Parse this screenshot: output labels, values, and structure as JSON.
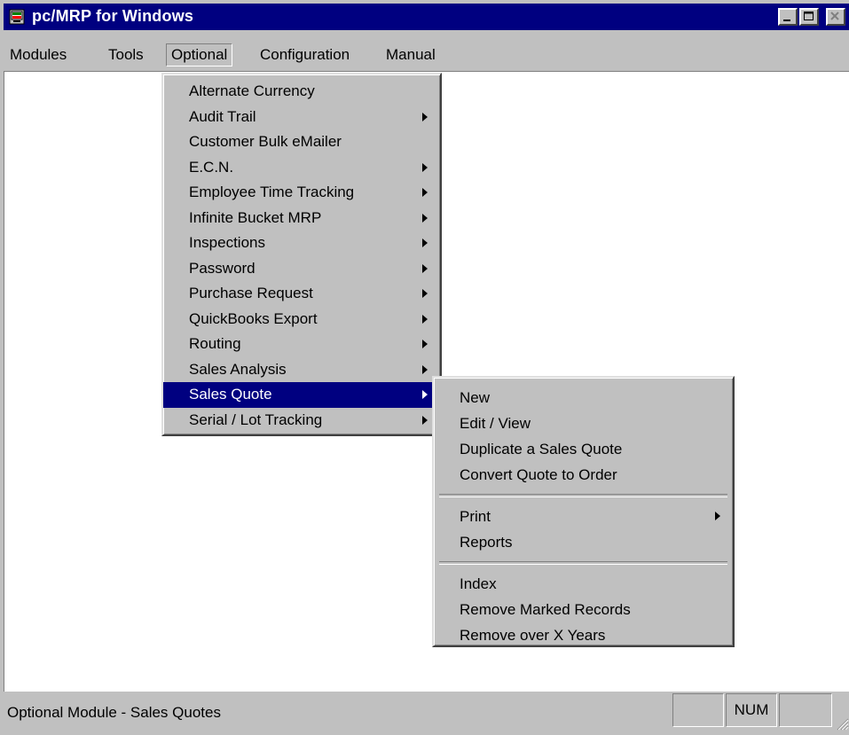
{
  "window": {
    "title": "pc/MRP for Windows"
  },
  "menubar": {
    "items": [
      "Modules",
      "Tools",
      "Optional",
      "Configuration",
      "Manual"
    ]
  },
  "optional_menu": {
    "items": [
      {
        "label": "Alternate Currency",
        "submenu": false
      },
      {
        "label": "Audit Trail",
        "submenu": true
      },
      {
        "label": "Customer Bulk eMailer",
        "submenu": false
      },
      {
        "label": "E.C.N.",
        "submenu": true
      },
      {
        "label": "Employee Time Tracking",
        "submenu": true
      },
      {
        "label": "Infinite Bucket MRP",
        "submenu": true
      },
      {
        "label": "Inspections",
        "submenu": true
      },
      {
        "label": "Password",
        "submenu": true
      },
      {
        "label": "Purchase Request",
        "submenu": true
      },
      {
        "label": "QuickBooks Export",
        "submenu": true
      },
      {
        "label": "Routing",
        "submenu": true
      },
      {
        "label": "Sales Analysis",
        "submenu": true
      },
      {
        "label": "Sales Quote",
        "submenu": true,
        "highlighted": true
      },
      {
        "label": "Serial / Lot Tracking",
        "submenu": true
      }
    ]
  },
  "sales_quote_menu": {
    "items": [
      {
        "label": "New"
      },
      {
        "label": "Edit / View"
      },
      {
        "label": "Duplicate a Sales Quote"
      },
      {
        "label": "Convert Quote to Order"
      },
      {
        "label": "Print",
        "submenu": true
      },
      {
        "label": "Reports"
      },
      {
        "label": "Index"
      },
      {
        "label": "Remove Marked Records"
      },
      {
        "label": "Remove over X Years"
      }
    ]
  },
  "statusbar": {
    "text": "Optional Module - Sales Quotes",
    "panel1": "",
    "num": "NUM",
    "panel3": ""
  },
  "colors": {
    "titlebar": "#000080",
    "face": "#c0c0c0",
    "highlight": "#000080",
    "client": "#ffffff"
  }
}
